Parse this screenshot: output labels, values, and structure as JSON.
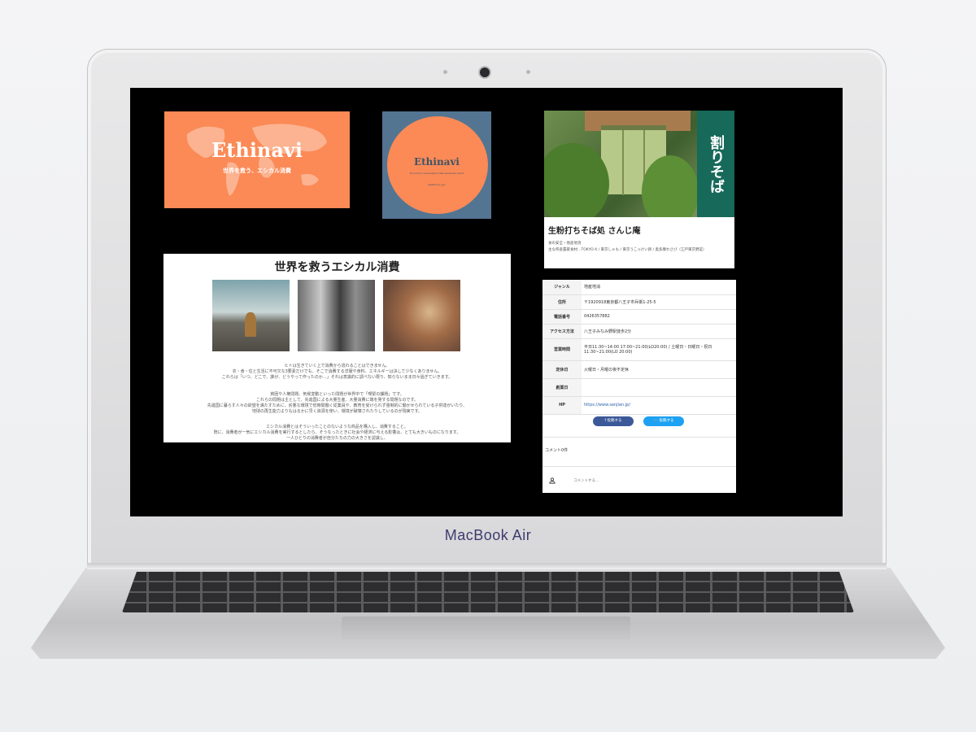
{
  "device": {
    "brand_label": "MacBook Air"
  },
  "logo_banner": {
    "name": "Ethinavi",
    "subtitle": "世界を救う、エシカル消費"
  },
  "logo_badge": {
    "name": "Ethinavi",
    "tagline": "Economic consumption that saves the world",
    "handle": "@ethinavi_jpn",
    "colors": {
      "background": "#537592",
      "circle": "#fb8a56"
    }
  },
  "shop_card": {
    "title": "生粉打ちそば処 さんじ庵",
    "description": "食の安全・地産地消\n主な県産農家食材…TOKYO-X / 東京しゃも / 東京うこっけい卵 / 奥多摩わさび（江戸東京野菜）",
    "banner_text": "割りそば"
  },
  "article": {
    "headline": "世界を救うエシカル消費",
    "paragraphs": [
      "ヒトは生きていく上で消費から逃れることはできません。\n衣・食・住と生活に不可欠な3要素だけでも、そこで消費する洋服や食料、エネルギーは決して少なくありません。\nこれらは「いつ、どこで、誰が、どうやって作ったのか…」それは意識的に調べない限り、知らないまま日々過ぎていきます。",
      "貧困や人権問題、気候変動といった問題が世界中で「喫緊の課題」です。\nこれらの問題は主として、先進国による大量生産、大量消費に端を発する問題なのです。\n先進国に暮らす人々の欲望を満たすために、劣悪な環境で低時間働く従業員や、教育を受けられず強制的に働かせられている子供達がいたり、\n地球の再生能力よりもはるかに早く資源を使い、環境が破壊されたりしているのが現実です。",
      "エシカル消費とはそういったことのないような商品を購入し、消費すること。\n既に、消費者が一気にエシカル消費を実行するとしたら、そうなったときに社会や経済に与える影響は、とても大きいものになります。\n一人ひとりの消費者が自分たちの力の大きさを認識し、"
    ]
  },
  "info_table": {
    "rows": [
      {
        "key": "ジャンル",
        "value": "地産地消"
      },
      {
        "key": "住所",
        "value": "〒1920918東京都八王子市兵衛1-25-5"
      },
      {
        "key": "電話番号",
        "value": "0426357882"
      },
      {
        "key": "アクセス方法",
        "value": "八王子みなみ野駅徒歩2分"
      },
      {
        "key": "営業時間",
        "value": "平日11:30~14:00 17:00~21:00(LO20:00) / 土曜日・日曜日・祝日11:30~21:00(LO 20:00)"
      },
      {
        "key": "定休日",
        "value": "火曜日・月曜の夜不定休"
      },
      {
        "key": "創業日",
        "value": ""
      },
      {
        "key": "HP",
        "value": "https://www.sanjian.jp/"
      }
    ],
    "share_facebook": "f 投稿する",
    "share_twitter": "🐦 投稿する",
    "comments_count": "コメント0件",
    "comment_placeholder": "コメントする..."
  }
}
